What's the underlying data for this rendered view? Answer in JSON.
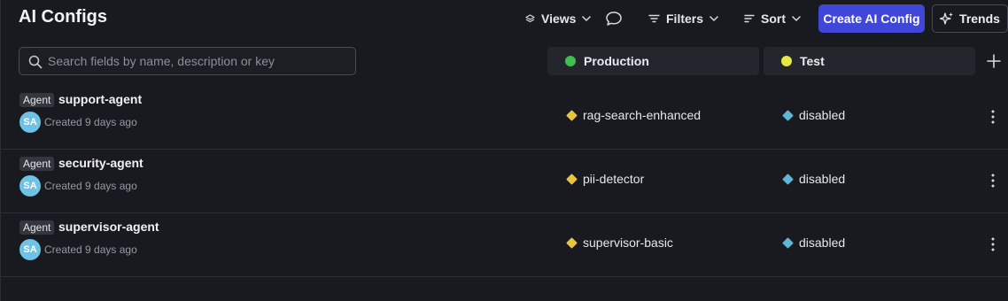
{
  "header": {
    "title": "AI Configs",
    "views_label": "Views",
    "filters_label": "Filters",
    "sort_label": "Sort",
    "create_label": "Create AI Config",
    "trends_label": "Trends"
  },
  "search": {
    "placeholder": "Search fields by name, description or key",
    "value": ""
  },
  "environments": [
    {
      "name": "Production",
      "color": "#3fbf4f"
    },
    {
      "name": "Test",
      "color": "#e6e943"
    }
  ],
  "colors": {
    "accent": "#4046d8",
    "production_variation": "#e9c53c",
    "test_variation": "#5bb8d6",
    "avatar": "#6cc3e6"
  },
  "rows": [
    {
      "tag": "Agent",
      "name": "support-agent",
      "avatar": "SA",
      "created": "Created 9 days ago",
      "production": "rag-search-enhanced",
      "test": "disabled"
    },
    {
      "tag": "Agent",
      "name": "security-agent",
      "avatar": "SA",
      "created": "Created 9 days ago",
      "production": "pii-detector",
      "test": "disabled"
    },
    {
      "tag": "Agent",
      "name": "supervisor-agent",
      "avatar": "SA",
      "created": "Created 9 days ago",
      "production": "supervisor-basic",
      "test": "disabled"
    }
  ]
}
